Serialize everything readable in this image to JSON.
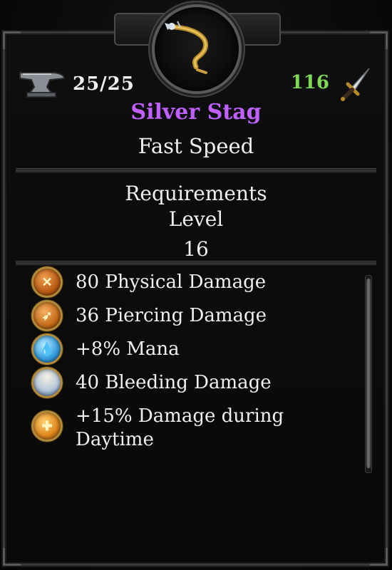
{
  "item": {
    "name": "Silver Stag",
    "speed": "Fast Speed",
    "durability": "25/25",
    "damage": "116",
    "name_color": "#c060ff",
    "damage_color": "#7ed956"
  },
  "requirements": {
    "title": "Requirements",
    "label": "Level",
    "value": "16"
  },
  "stats": [
    {
      "text": "80 Physical Damage",
      "icon": "physical-damage-icon",
      "color": "#c8641e"
    },
    {
      "text": "36 Piercing Damage",
      "icon": "piercing-damage-icon",
      "color": "#d07020"
    },
    {
      "text": "+8% Mana",
      "icon": "mana-icon",
      "color": "#3a9fe0"
    },
    {
      "text": "40 Bleeding Damage",
      "icon": "bleeding-damage-icon",
      "color": "#c8b890"
    },
    {
      "text": "+15% Damage during Daytime",
      "icon": "daytime-damage-icon",
      "color": "#e08a20"
    }
  ],
  "icons": {
    "weapon": "bow-icon",
    "durability": "anvil-icon",
    "damage": "dagger-icon"
  }
}
